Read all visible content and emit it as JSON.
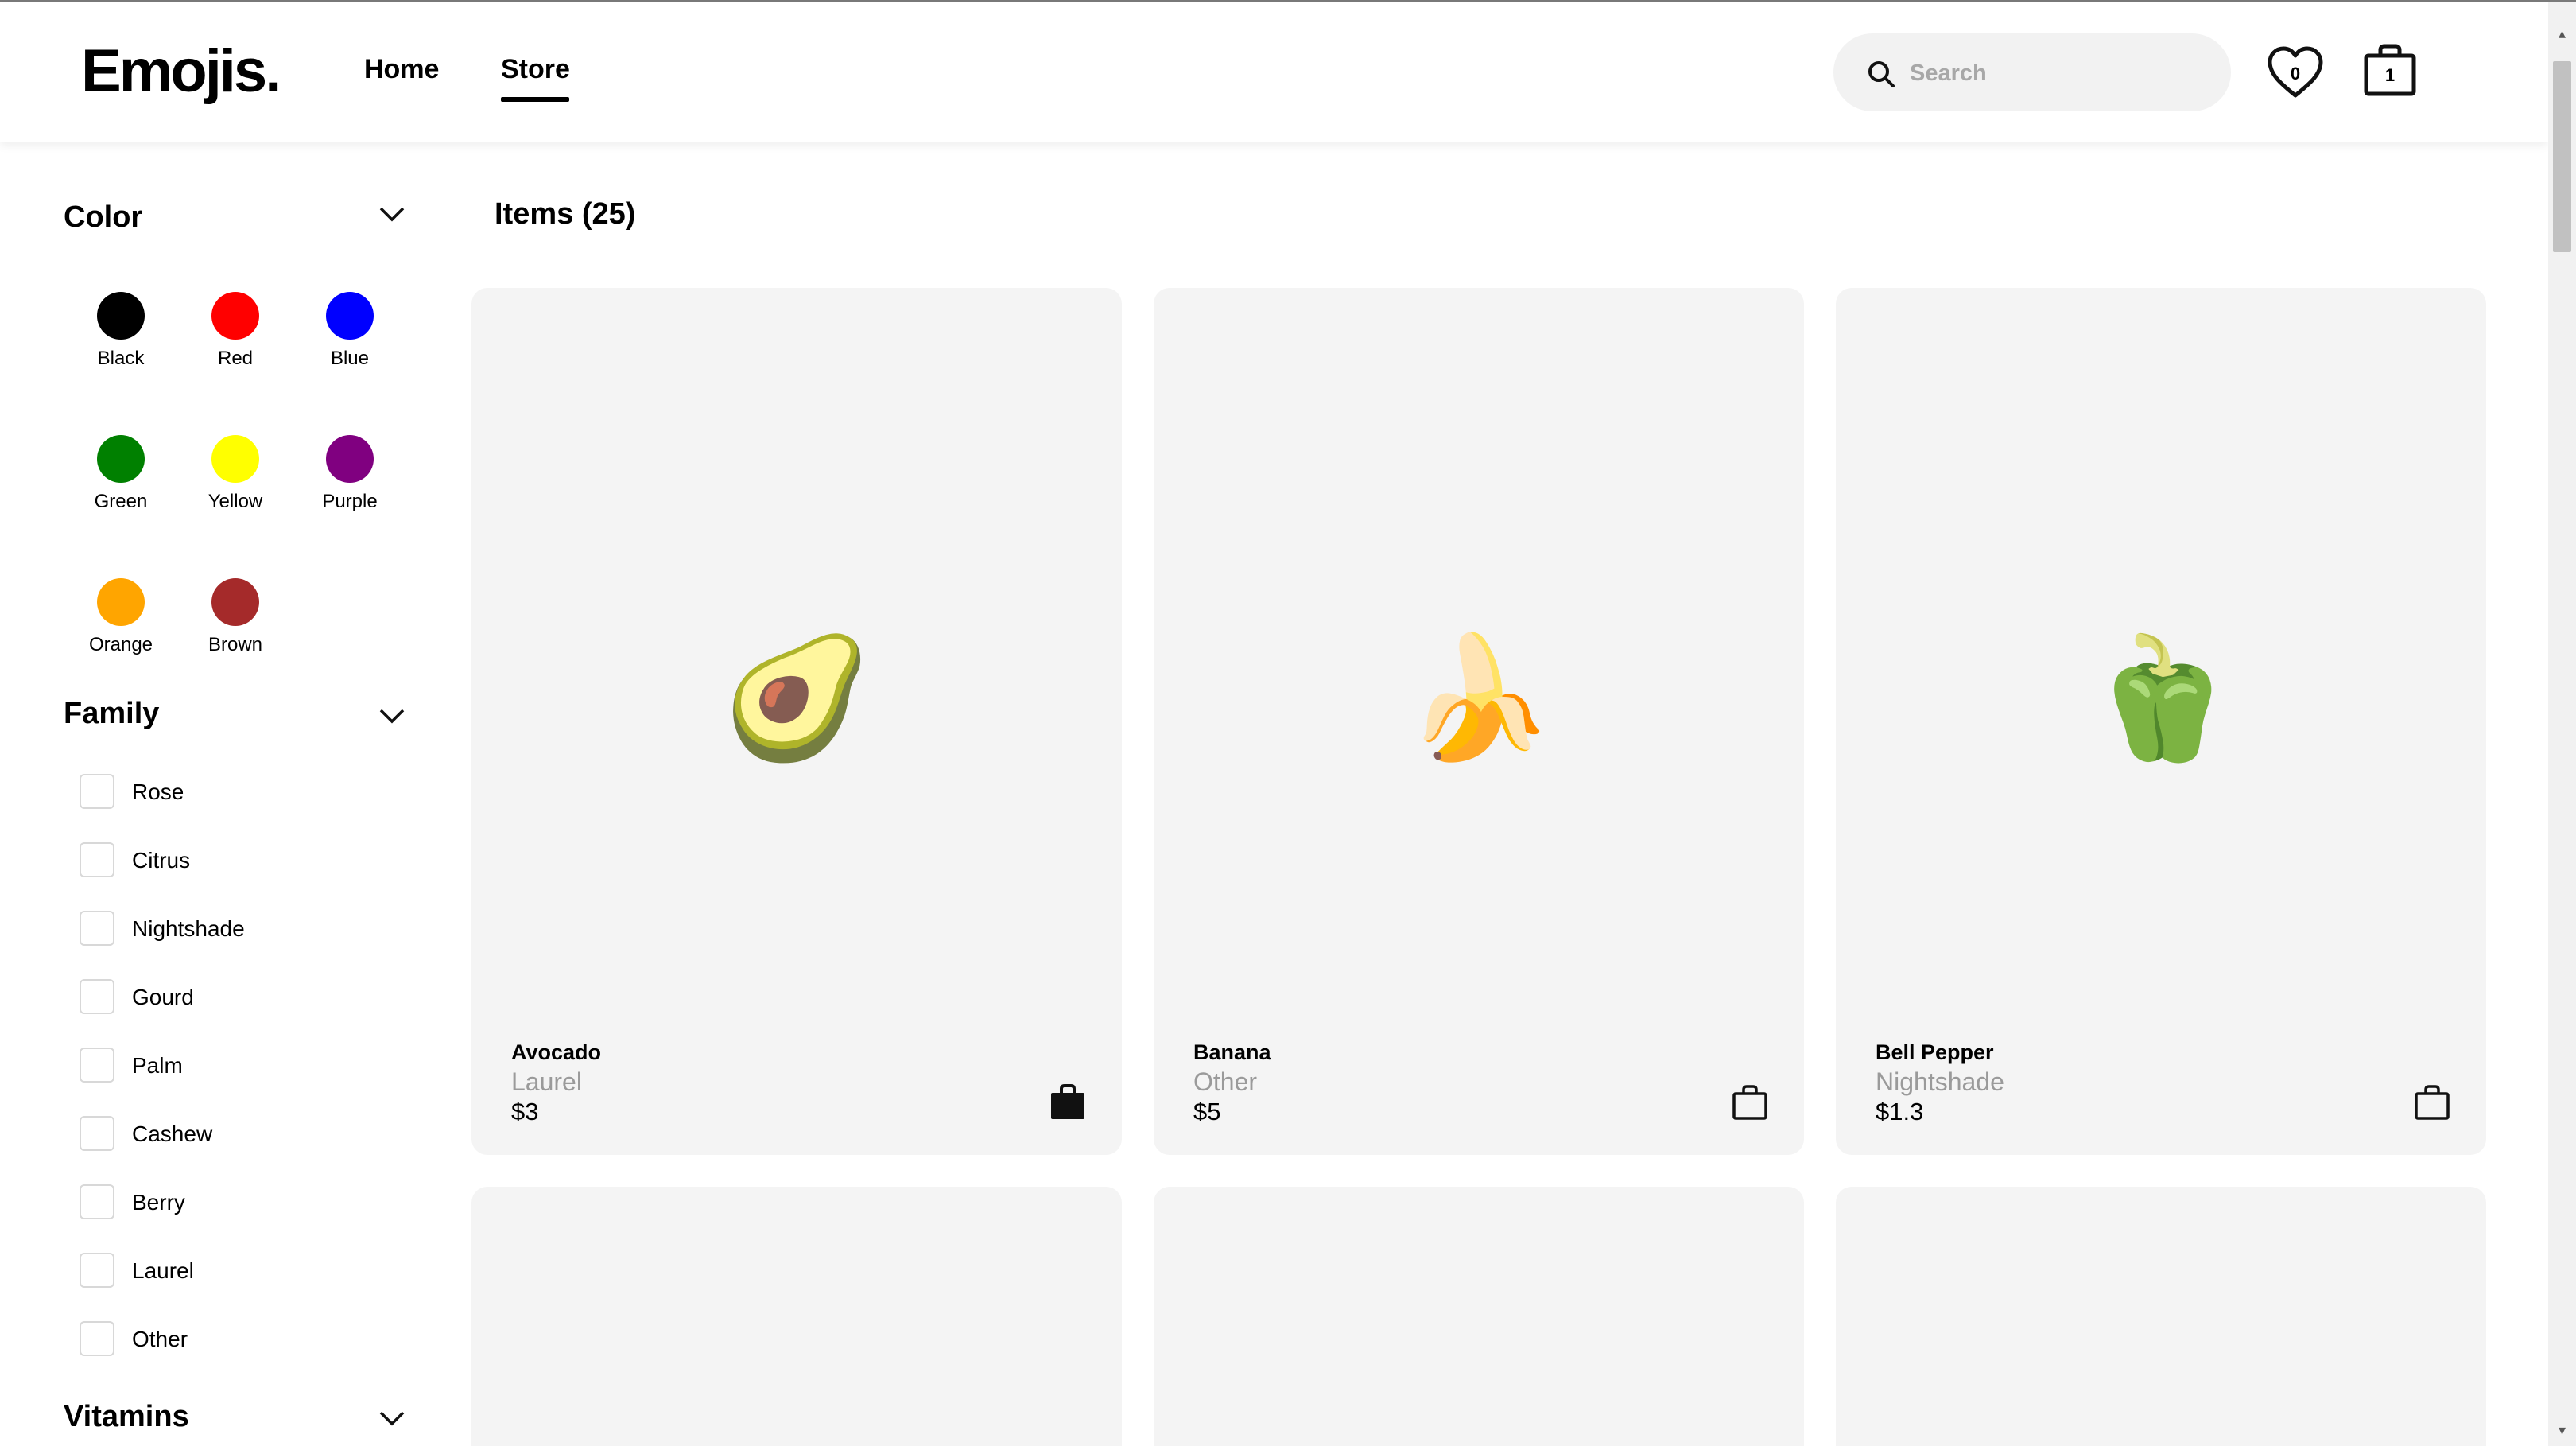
{
  "header": {
    "logo": "Emojis.",
    "nav": [
      {
        "label": "Home",
        "active": false
      },
      {
        "label": "Store",
        "active": true
      }
    ],
    "search_placeholder": "Search",
    "wishlist_count": "0",
    "cart_count": "1"
  },
  "sidebar": {
    "color_title": "Color",
    "colors": [
      {
        "label": "Black",
        "hex": "#000000"
      },
      {
        "label": "Red",
        "hex": "#ff0000"
      },
      {
        "label": "Blue",
        "hex": "#0000ff"
      },
      {
        "label": "Green",
        "hex": "#008000"
      },
      {
        "label": "Yellow",
        "hex": "#ffff00"
      },
      {
        "label": "Purple",
        "hex": "#800080"
      },
      {
        "label": "Orange",
        "hex": "#ffa500"
      },
      {
        "label": "Brown",
        "hex": "#a52a2a"
      }
    ],
    "family_title": "Family",
    "families": [
      "Rose",
      "Citrus",
      "Nightshade",
      "Gourd",
      "Palm",
      "Cashew",
      "Berry",
      "Laurel",
      "Other"
    ],
    "vitamins_title": "Vitamins"
  },
  "main": {
    "items_title": "Items (25)",
    "products": [
      {
        "name": "Avocado",
        "family": "Laurel",
        "price": "$3",
        "emoji": "🥑",
        "in_cart": true
      },
      {
        "name": "Banana",
        "family": "Other",
        "price": "$5",
        "emoji": "🍌",
        "in_cart": false
      },
      {
        "name": "Bell Pepper",
        "family": "Nightshade",
        "price": "$1.3",
        "emoji": "🫑",
        "in_cart": false
      }
    ]
  }
}
